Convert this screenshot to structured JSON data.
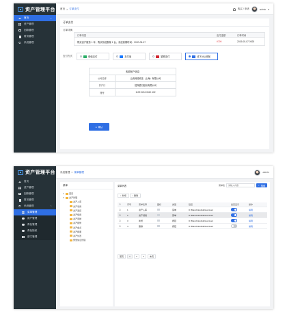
{
  "app": {
    "name": "资产管理平台"
  },
  "screen1": {
    "sidebar": [
      {
        "label": "首页",
        "icon": "home-icon",
        "active": true
      },
      {
        "label": "资产管理",
        "icon": "grid-icon"
      },
      {
        "label": "回款管理",
        "icon": "box-icon"
      },
      {
        "label": "财务管理",
        "icon": "doc-icon"
      },
      {
        "label": "系统管理",
        "icon": "gear-icon"
      }
    ],
    "breadcrumb": {
      "home": "首页",
      "sep": ">",
      "current": "订单支付"
    },
    "topbar": {
      "notice": "购买 / 申请",
      "user": "admin"
    },
    "title": "订单支付",
    "order_label": "订单详情",
    "order_table": {
      "headers": [
        "订单内容",
        "应付金额",
        "订单时间"
      ],
      "row": [
        "购买资产服务 1 年，购买系统数量 1 台，系统到期时间：2020-05-07",
        "¥799",
        "2019-05-07 0925"
      ]
    },
    "pay_label": "支付方式",
    "pay_methods": [
      {
        "label": "微信支付",
        "selected": false,
        "color": "#2aae67"
      },
      {
        "label": "支付宝",
        "selected": false,
        "color": "#1677ff"
      },
      {
        "label": "银联支付",
        "selected": false,
        "color": "#d2262f"
      },
      {
        "label": "线下对公转账",
        "selected": true,
        "color": "#2f6fe4"
      }
    ],
    "bank_info": {
      "header": "收款账户信息",
      "rows": [
        {
          "k": "公司名称",
          "v": "云资网络科技（上海）有限公司"
        },
        {
          "k": "开户行",
          "v": "招商银行股份有限公司"
        },
        {
          "k": "账号",
          "v": "1109 0216 0610 402"
        }
      ]
    },
    "confirm_label": "确认"
  },
  "screen2": {
    "sidebar": [
      {
        "label": "首页",
        "icon": "home-icon"
      },
      {
        "label": "资产管理",
        "icon": "grid-icon"
      },
      {
        "label": "回款管理",
        "icon": "box-icon"
      },
      {
        "label": "财务管理",
        "icon": "doc-icon"
      },
      {
        "label": "系统管理",
        "icon": "gear-icon",
        "open": true
      },
      {
        "label": "菜单管理",
        "icon": "grid-icon",
        "active": true,
        "sub": true
      },
      {
        "label": "用户管理",
        "icon": "user-icon",
        "sub": true
      },
      {
        "label": "角色管理",
        "icon": "user-icon",
        "sub": true
      },
      {
        "label": "角色授权",
        "icon": "user-icon",
        "sub": true
      },
      {
        "label": "部门管理",
        "icon": "dept-icon",
        "sub": true
      }
    ],
    "breadcrumb": {
      "home": "系统管理",
      "sep": ">",
      "current": "菜单管理"
    },
    "topbar": {
      "user": "admin"
    },
    "tree_title": "菜单",
    "tree": [
      {
        "label": "首页",
        "level": 1
      },
      {
        "label": "资产管理",
        "level": 1,
        "open": true
      },
      {
        "label": "资产入库",
        "level": 2
      },
      {
        "label": "资产领用",
        "level": 2
      },
      {
        "label": "资产退还",
        "level": 2
      },
      {
        "label": "资产借用",
        "level": 2
      },
      {
        "label": "资产调拨",
        "level": 2
      },
      {
        "label": "资产报修",
        "level": 2
      },
      {
        "label": "资产盘点",
        "level": 2
      },
      {
        "label": "资产报废",
        "level": 2
      },
      {
        "label": "资产处置",
        "level": 2
      },
      {
        "label": "预警信息管理",
        "level": 2
      }
    ],
    "list_title": "菜单列表",
    "search_label": "菜单名",
    "search_placeholder": "请输入内容",
    "search_button": "搜索",
    "add_button": "新增",
    "delete_button": "删除",
    "columns": [
      "序号",
      "菜单名称",
      "图标",
      "类型",
      "链接",
      "是否显示",
      "操作"
    ],
    "rows": [
      {
        "no": "1",
        "name": "资产入库",
        "type": "菜单",
        "link": "D:\\Baidu\\NetdiskDownload",
        "on": true,
        "op": "编辑",
        "hl": false
      },
      {
        "no": "2",
        "name": "资产领用",
        "type": "菜单",
        "link": "D:\\Baidu\\NetdiskDownload",
        "on": true,
        "op": "编辑",
        "hl": true
      },
      {
        "no": "3",
        "name": "新增",
        "type": "按钮",
        "link": "D:\\Baidu\\NetdiskDownload",
        "on": true,
        "op": "编辑",
        "hl": false
      },
      {
        "no": "4",
        "name": "删除",
        "type": "按钮",
        "link": "D:\\Baidu\\NetdiskDownload",
        "on": false,
        "op": "编辑",
        "hl": false
      }
    ],
    "pager": [
      "首页",
      "1",
      "2",
      "3",
      "末页"
    ]
  }
}
